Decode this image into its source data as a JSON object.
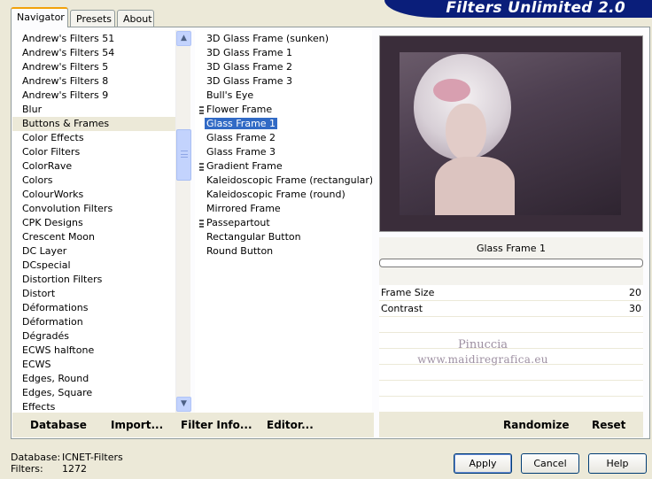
{
  "window": {
    "title": "Filters Unlimited 2.0"
  },
  "tabs": [
    {
      "label": "Navigator",
      "active": true
    },
    {
      "label": "Presets",
      "active": false
    },
    {
      "label": "About",
      "active": false
    }
  ],
  "categories": [
    "Andrew's Filters 51",
    "Andrew's Filters 54",
    "Andrew's Filters 5",
    "Andrew's Filters 8",
    "Andrew's Filters 9",
    "Blur",
    "Buttons & Frames",
    "Color Effects",
    "Color Filters",
    "ColorRave",
    "Colors",
    "ColourWorks",
    "Convolution Filters",
    "CPK Designs",
    "Crescent Moon",
    "DC Layer",
    "DCspecial",
    "Distortion Filters",
    "Distort",
    "Déformations",
    "Déformation",
    "Dégradés",
    "ECWS halftone",
    "ECWS",
    "Edges, Round",
    "Edges, Square",
    "Effects"
  ],
  "selected_category": "Buttons & Frames",
  "filters": [
    {
      "label": "3D Glass Frame (sunken)",
      "marked": false
    },
    {
      "label": "3D Glass Frame 1",
      "marked": false
    },
    {
      "label": "3D Glass Frame 2",
      "marked": false
    },
    {
      "label": "3D Glass Frame 3",
      "marked": false
    },
    {
      "label": "Bull's Eye",
      "marked": false
    },
    {
      "label": "Flower Frame",
      "marked": true
    },
    {
      "label": "Glass Frame 1",
      "marked": false,
      "selected": true
    },
    {
      "label": "Glass Frame 2",
      "marked": false
    },
    {
      "label": "Glass Frame 3",
      "marked": false
    },
    {
      "label": "Gradient Frame",
      "marked": true
    },
    {
      "label": "Kaleidoscopic Frame (rectangular)",
      "marked": false
    },
    {
      "label": "Kaleidoscopic Frame (round)",
      "marked": false
    },
    {
      "label": "Mirrored Frame",
      "marked": false
    },
    {
      "label": "Passepartout",
      "marked": true
    },
    {
      "label": "Rectangular Button",
      "marked": false
    },
    {
      "label": "Round Button",
      "marked": false
    }
  ],
  "params": {
    "title": "Glass Frame 1",
    "rows": [
      {
        "name": "Frame Size",
        "value": "20"
      },
      {
        "name": "Contrast",
        "value": "30"
      },
      {
        "name": "",
        "value": ""
      },
      {
        "name": "",
        "value": ""
      },
      {
        "name": "",
        "value": ""
      },
      {
        "name": "",
        "value": ""
      },
      {
        "name": "",
        "value": ""
      },
      {
        "name": "",
        "value": ""
      }
    ]
  },
  "watermark": {
    "line1": "Pinuccia",
    "line2": "www.maidiregrafica.eu"
  },
  "toolbar": {
    "database": "Database",
    "import": "Import...",
    "filter_info": "Filter Info...",
    "editor": "Editor...",
    "randomize": "Randomize",
    "reset": "Reset"
  },
  "status": {
    "database_label": "Database:",
    "database_value": "ICNET-Filters",
    "filters_label": "Filters:",
    "filters_value": "1272"
  },
  "buttons": {
    "apply": "Apply",
    "cancel": "Cancel",
    "help": "Help"
  },
  "colors": {
    "banner": "#0a1e7a",
    "selection": "#316ac5",
    "tab_accent": "#f2a10b"
  }
}
